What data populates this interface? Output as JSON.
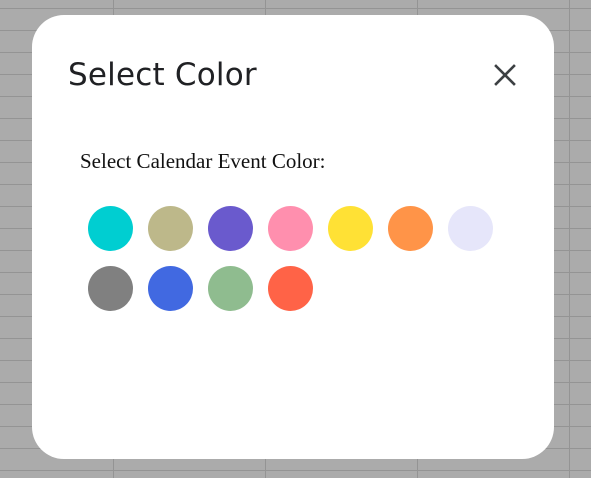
{
  "dialog": {
    "title": "Select Color",
    "close_icon": "close-icon",
    "prompt": "Select Calendar Event Color:"
  },
  "swatches": [
    {
      "color": "#00CED1"
    },
    {
      "color": "#BDB88A"
    },
    {
      "color": "#6A5ACD"
    },
    {
      "color": "#FF8FAE"
    },
    {
      "color": "#FFE135"
    },
    {
      "color": "#FF9448"
    },
    {
      "color": "#E6E6FA"
    },
    {
      "color": "#808080"
    },
    {
      "color": "#4169E1"
    },
    {
      "color": "#8FBC8F"
    },
    {
      "color": "#FF6347"
    }
  ]
}
